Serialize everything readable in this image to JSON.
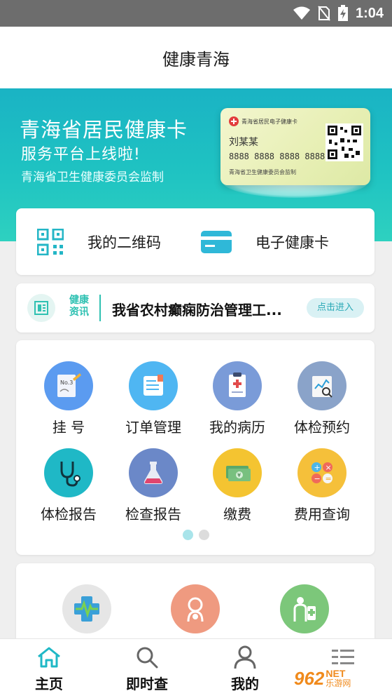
{
  "status_bar": {
    "time": "1:04"
  },
  "header": {
    "title": "健康青海"
  },
  "banner": {
    "line1": "青海省居民健康卡",
    "line2": "服务平台上线啦!",
    "line3": "青海省卫生健康委员会监制",
    "card": {
      "title": "青海省居民电子健康卡",
      "name": "刘某某",
      "number": "8888 8888 8888 8888",
      "issuer": "青海省卫生健康委员会监制"
    }
  },
  "quick_actions": {
    "qr_code_label": "我的二维码",
    "health_card_label": "电子健康卡"
  },
  "news": {
    "tag": "健康资讯",
    "headline": "我省农村癫痫防治管理工...",
    "button_label": "点击进入"
  },
  "services": {
    "items": [
      {
        "label": "挂  号",
        "icon": "registration-icon",
        "color": "#5b9bf0"
      },
      {
        "label": "订单管理",
        "icon": "order-icon",
        "color": "#4fb6f2"
      },
      {
        "label": "我的病历",
        "icon": "medical-record-icon",
        "color": "#7a9bd8"
      },
      {
        "label": "体检预约",
        "icon": "checkup-appointment-icon",
        "color": "#8aa3c9"
      },
      {
        "label": "体检报告",
        "icon": "stethoscope-icon",
        "color": "#1fb8c6"
      },
      {
        "label": "检查报告",
        "icon": "flask-icon",
        "color": "#6b88c8"
      },
      {
        "label": "缴费",
        "icon": "payment-icon",
        "color": "#f4c431"
      },
      {
        "label": "费用查询",
        "icon": "calculator-icon",
        "color": "#f5c03a"
      }
    ],
    "page_index": 1,
    "page_count": 2
  },
  "bottom_shortcuts": [
    {
      "icon": "health-monitor-icon",
      "color": "#e6e6e6"
    },
    {
      "icon": "maternal-icon",
      "color": "#ef9a80"
    },
    {
      "icon": "medicine-icon",
      "color": "#7cc77a"
    }
  ],
  "tab_bar": {
    "tabs": [
      {
        "label": "主页",
        "icon": "home-icon",
        "active": true
      },
      {
        "label": "即时查",
        "icon": "search-icon",
        "active": false
      },
      {
        "label": "我的",
        "icon": "user-icon",
        "active": false
      },
      {
        "label": "",
        "icon": "more-icon",
        "active": false
      }
    ]
  },
  "watermark": {
    "brand": "962",
    "net": "NET",
    "site": "乐游网"
  },
  "colors": {
    "accent": "#1fc3c2",
    "tab_active": "#1fb8c6"
  }
}
